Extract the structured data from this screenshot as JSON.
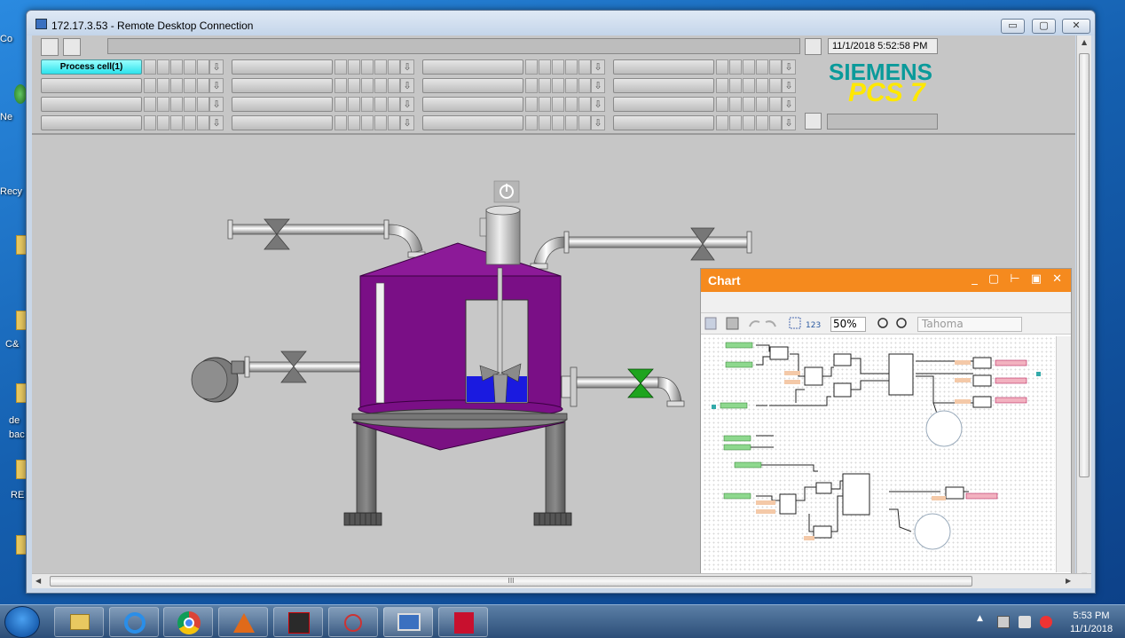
{
  "window": {
    "title": "172.17.3.53 - Remote Desktop Connection",
    "min_label": "▭",
    "max_label": "▢",
    "close_label": "✕"
  },
  "desktop_icons": [
    "Co",
    "Ne",
    "Recy",
    "C&",
    "de\nbac",
    "RE"
  ],
  "header": {
    "datetime": "11/1/2018 5:52:58 PM",
    "brand": "SIEMENS",
    "product": "PCS 7",
    "area_button": "Process cell(1)",
    "area_arrow": "⇩"
  },
  "chart": {
    "title": "Chart",
    "zoom": "50%",
    "font": "Tahoma",
    "num_btn": "123",
    "header_btns": "_ ▢ ⊢ ▣ ✕"
  },
  "hscroll": {
    "thumb": "III"
  },
  "taskbar": {
    "time": "5:53 PM",
    "date": "11/1/2018"
  }
}
